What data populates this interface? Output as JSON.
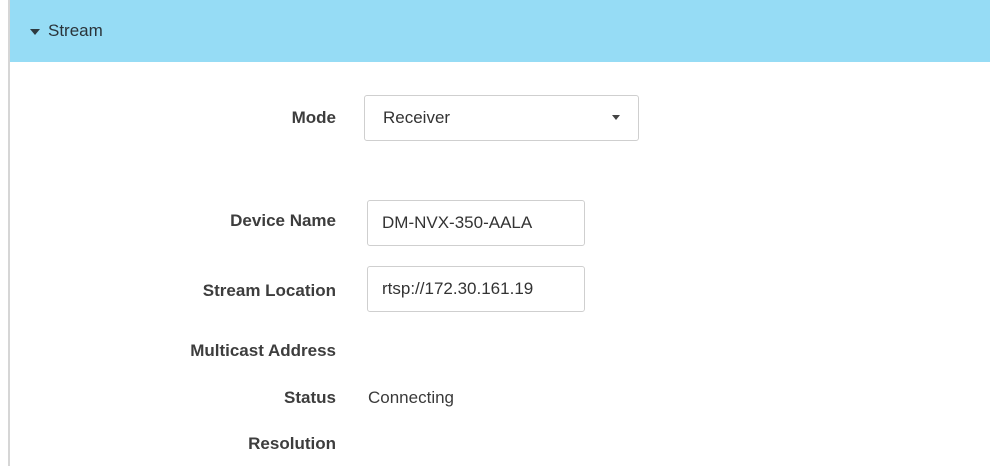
{
  "section": {
    "title": "Stream"
  },
  "fields": {
    "mode": {
      "label": "Mode",
      "value": "Receiver"
    },
    "device_name": {
      "label": "Device Name",
      "value": "DM-NVX-350-AALA"
    },
    "stream_location": {
      "label": "Stream Location",
      "value": "rtsp://172.30.161.19"
    },
    "multicast_address": {
      "label": "Multicast Address",
      "value": ""
    },
    "status": {
      "label": "Status",
      "value": "Connecting"
    },
    "resolution": {
      "label": "Resolution",
      "value": ""
    }
  },
  "colors": {
    "header_background": "#96dcf5"
  },
  "icons": {
    "section_toggle": "caret-down-icon",
    "mode_dropdown": "chevron-down-icon"
  }
}
